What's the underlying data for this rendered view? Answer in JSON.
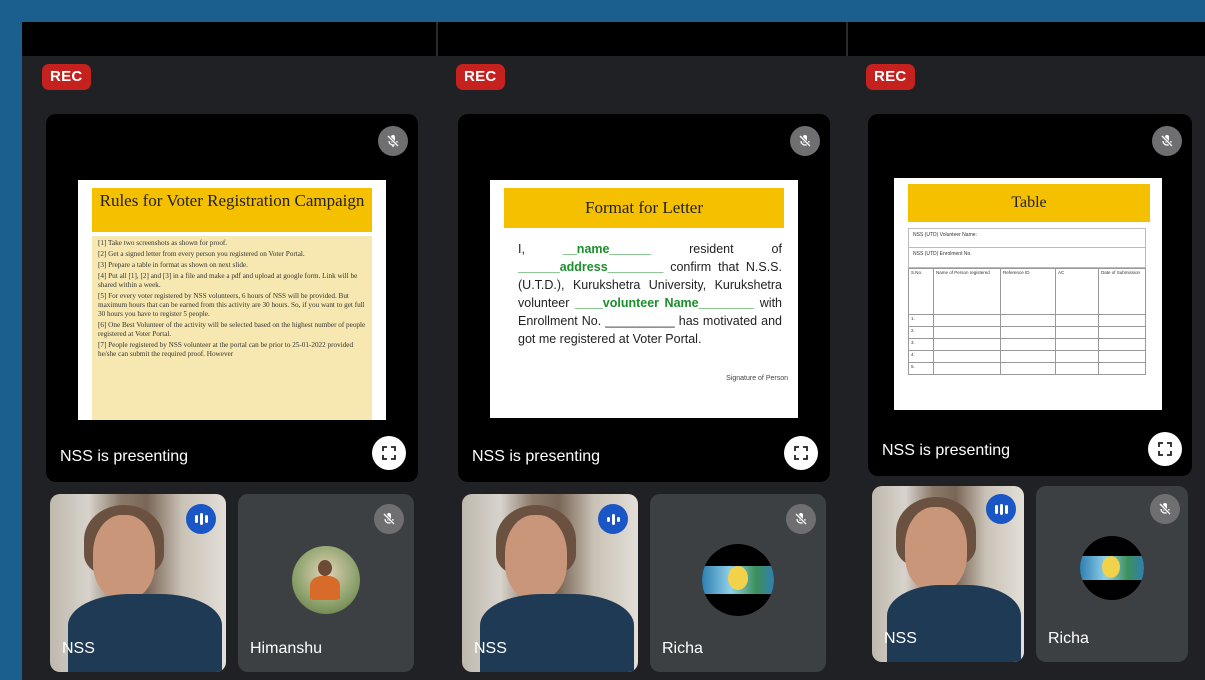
{
  "columns": [
    {
      "rec_label": "REC",
      "presenting_label": "NSS is presenting",
      "slide": {
        "title": "Rules for Voter Registration Campaign",
        "lines": [
          "[1] Take two screenshots as shown for proof.",
          "[2] Get a signed letter from every person you registered on Voter Portal.",
          "[3] Prepare a table in format as shown on next slide.",
          "[4] Put all [1], [2] and [3] in a file and make a pdf and upload at google form. Link will be shared within a week.",
          "[5] For every voter registered by NSS volunteers, 6 hours of NSS will be provided. But maximum hours that can be earned from this activity are 30 hours. So, if you want to get full 30 hours you have to register 5 people.",
          "[6] One Best Volunteer of the activity will be selected based on the highest number of people registered at Voter Portal.",
          "[7] People registered by NSS volunteer at the portal can be prior to 25-01-2022 provided he/she can submit the required proof. However"
        ]
      },
      "participants": [
        {
          "name": "NSS",
          "speaking": true
        },
        {
          "name": "Himanshu",
          "muted": true
        }
      ]
    },
    {
      "rec_label": "REC",
      "presenting_label": "NSS is presenting",
      "slide": {
        "title": "Format for Letter",
        "letter": {
          "p1": "I,",
          "name": "__name______",
          "p2": "resident of",
          "address": "______address________",
          "p3": "confirm that N.S.S. (U.T.D.), Kurukshetra University, Kurukshetra volunteer",
          "volunteer": "____volunteer Name________",
          "p4": "with Enrollment No. __________ has motivated and got me registered at Voter Portal."
        },
        "signature": "Signature of Person"
      },
      "participants": [
        {
          "name": "NSS",
          "speaking": true
        },
        {
          "name": "Richa",
          "muted": true
        }
      ]
    },
    {
      "rec_label": "REC",
      "presenting_label": "NSS is presenting",
      "slide": {
        "title": "Table",
        "row1": "NSS (UTD) Volunteer Name:",
        "row2": "NSS (UTD) Enrolment No.",
        "headers": [
          "S.No.",
          "Name of Person registered",
          "Reference ID",
          "AC",
          "Date of Submission"
        ],
        "row_numbers": [
          "1.",
          "2.",
          "3.",
          "4.",
          "5."
        ]
      },
      "participants": [
        {
          "name": "NSS",
          "speaking": true
        },
        {
          "name": "Richa",
          "muted": true
        }
      ]
    }
  ],
  "icons": {
    "mic_off": "mic-off-icon",
    "fullscreen": "fullscreen-icon",
    "speaking": "audio-level-icon"
  },
  "colors": {
    "rec": "#c5221f",
    "slide_title_bg": "#f5c000",
    "tile_bg": "#3c4043",
    "speaking": "#1a56c6"
  }
}
